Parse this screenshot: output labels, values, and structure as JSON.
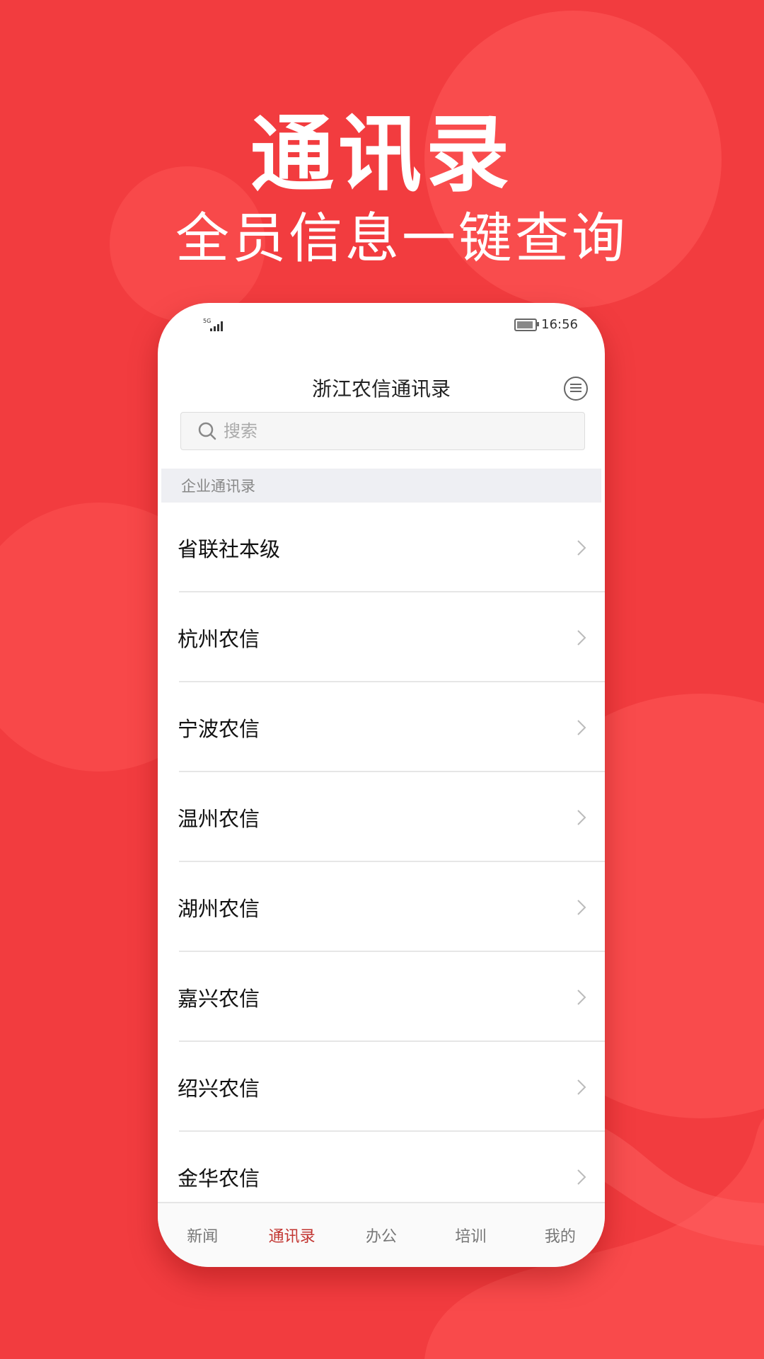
{
  "promo": {
    "title": "通讯录",
    "subtitle": "全员信息一键查询"
  },
  "status_bar": {
    "network": "5G",
    "time": "16:56",
    "battery_level": 0.9
  },
  "header": {
    "title": "浙江农信通讯录",
    "menu_icon": "menu-icon"
  },
  "search": {
    "placeholder": "搜索"
  },
  "section": {
    "label": "企业通讯录"
  },
  "directory": {
    "items": [
      {
        "label": "省联社本级"
      },
      {
        "label": "杭州农信"
      },
      {
        "label": "宁波农信"
      },
      {
        "label": "温州农信"
      },
      {
        "label": "湖州农信"
      },
      {
        "label": "嘉兴农信"
      },
      {
        "label": "绍兴农信"
      },
      {
        "label": "金华农信"
      }
    ]
  },
  "tabbar": {
    "tabs": [
      {
        "label": "新闻",
        "active": false
      },
      {
        "label": "通讯录",
        "active": true
      },
      {
        "label": "办公",
        "active": false
      },
      {
        "label": "培训",
        "active": false
      },
      {
        "label": "我的",
        "active": false
      }
    ]
  },
  "colors": {
    "background": "#f23c3f",
    "accent": "#c23531"
  }
}
